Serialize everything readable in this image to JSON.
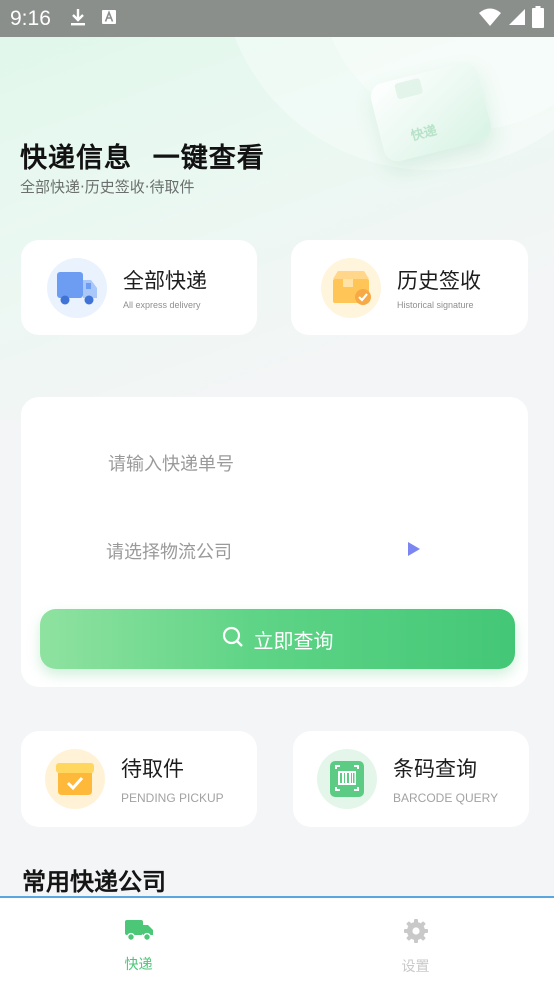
{
  "status_bar": {
    "time": "9:16"
  },
  "hero": {
    "title": "快递信息  一键查看",
    "subtitle": "全部快递·历史签收·待取件",
    "box_label": "快递"
  },
  "quick_cards": [
    {
      "title": "全部快递",
      "subtitle": "All express delivery",
      "icon": "truck-icon"
    },
    {
      "title": "历史签收",
      "subtitle": "Historical signature",
      "icon": "package-check-icon"
    }
  ],
  "search_form": {
    "tracking_placeholder": "请输入快递单号",
    "company_placeholder": "请选择物流公司",
    "query_label": "立即查询"
  },
  "feature_cards": [
    {
      "title": "待取件",
      "subtitle": "PENDING PICKUP",
      "icon": "pickup-box-icon"
    },
    {
      "title": "条码查询",
      "subtitle": "BARCODE QUERY",
      "icon": "barcode-scan-icon"
    }
  ],
  "section": {
    "title": "常用快递公司"
  },
  "tabbar": {
    "items": [
      {
        "label": "快递",
        "icon": "truck-icon",
        "active": true
      },
      {
        "label": "设置",
        "icon": "gear-icon",
        "active": false
      }
    ]
  },
  "colors": {
    "accent_green": "#4cc778",
    "tab_active": "#4cc778",
    "tab_inactive": "#c9c9c9",
    "select_arrow": "#7b86f2"
  }
}
